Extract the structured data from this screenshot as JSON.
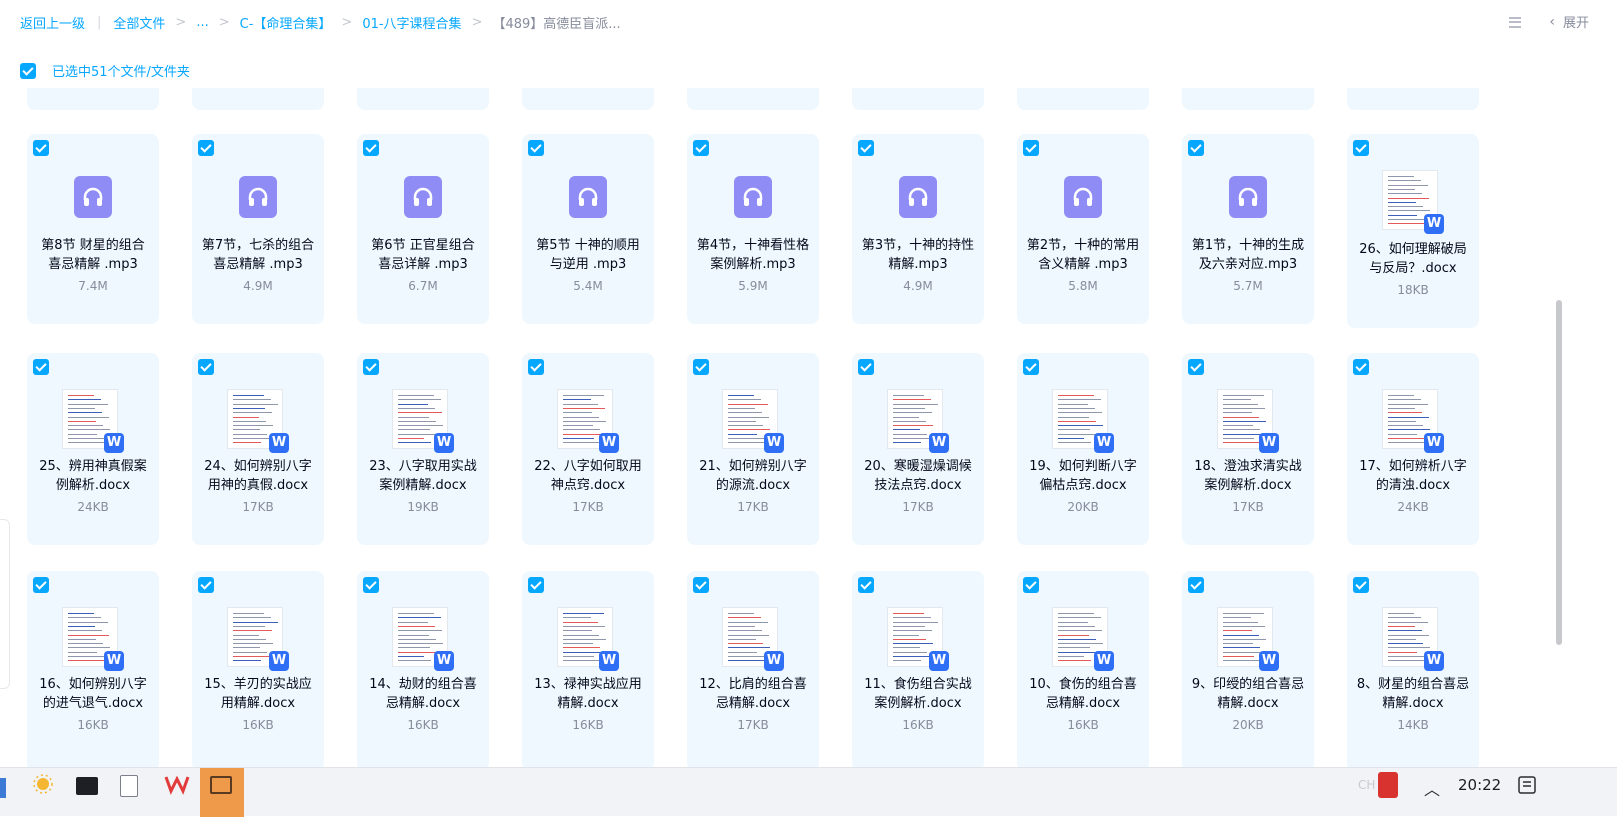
{
  "breadcrumb": {
    "back": "返回上一级",
    "all_files": "全部文件",
    "ellipsis": "...",
    "crumb1": "C-【命理合集】",
    "crumb2": "01-八字课程合集",
    "current": "【489】高德臣盲派..."
  },
  "toolbar": {
    "expand_label": "展开"
  },
  "selection": {
    "label": "已选中51个文件/文件夹"
  },
  "colors": {
    "accent": "#06a7ff",
    "card_bg": "#eef8fe",
    "audio_icon": "#8f8cf5",
    "word_badge": "#2f6ff5"
  },
  "files": {
    "row1": [
      {
        "name_l1": "第8节 财星的组合",
        "name_l2": "喜忌精解 .mp3",
        "size": "7.4M",
        "type": "audio"
      },
      {
        "name_l1": "第7节，七杀的组合",
        "name_l2": "喜忌精解 .mp3",
        "size": "4.9M",
        "type": "audio"
      },
      {
        "name_l1": "第6节 正官星组合",
        "name_l2": "喜忌详解 .mp3",
        "size": "6.7M",
        "type": "audio"
      },
      {
        "name_l1": "第5节 十神的顺用",
        "name_l2": "与逆用 .mp3",
        "size": "5.4M",
        "type": "audio"
      },
      {
        "name_l1": "第4节，十神看性格",
        "name_l2": "案例解析.mp3",
        "size": "5.9M",
        "type": "audio"
      },
      {
        "name_l1": "第3节，十神的持性",
        "name_l2": "精解.mp3",
        "size": "4.9M",
        "type": "audio"
      },
      {
        "name_l1": "第2节，十种的常用",
        "name_l2": "含义精解 .mp3",
        "size": "5.8M",
        "type": "audio"
      },
      {
        "name_l1": "第1节，十神的生成",
        "name_l2": "及六亲对应.mp3",
        "size": "5.7M",
        "type": "audio"
      },
      {
        "name_l1": "26、如何理解破局",
        "name_l2": "与反局？.docx",
        "size": "18KB",
        "type": "docx"
      }
    ],
    "row2": [
      {
        "name_l1": "25、辨用神真假案",
        "name_l2": "例解析.docx",
        "size": "24KB",
        "type": "docx"
      },
      {
        "name_l1": "24、如何辨别八字",
        "name_l2": "用神的真假.docx",
        "size": "17KB",
        "type": "docx"
      },
      {
        "name_l1": "23、八字取用实战",
        "name_l2": "案例精解.docx",
        "size": "19KB",
        "type": "docx"
      },
      {
        "name_l1": "22、八字如何取用",
        "name_l2": "神点窍.docx",
        "size": "17KB",
        "type": "docx"
      },
      {
        "name_l1": "21、如何辨别八字",
        "name_l2": "的源流.docx",
        "size": "17KB",
        "type": "docx"
      },
      {
        "name_l1": "20、寒暖湿燥调候",
        "name_l2": "技法点窍.docx",
        "size": "17KB",
        "type": "docx"
      },
      {
        "name_l1": "19、如何判断八字",
        "name_l2": "偏枯点窍.docx",
        "size": "20KB",
        "type": "docx"
      },
      {
        "name_l1": "18、澄浊求清实战",
        "name_l2": "案例解析.docx",
        "size": "17KB",
        "type": "docx"
      },
      {
        "name_l1": "17、如何辨析八字",
        "name_l2": "的清浊.docx",
        "size": "24KB",
        "type": "docx"
      }
    ],
    "row3": [
      {
        "name_l1": "16、如何辨别八字",
        "name_l2": "的进气退气.docx",
        "size": "16KB",
        "type": "docx"
      },
      {
        "name_l1": "15、羊刃的实战应",
        "name_l2": "用精解.docx",
        "size": "16KB",
        "type": "docx"
      },
      {
        "name_l1": "14、劫财的组合喜",
        "name_l2": "忌精解.docx",
        "size": "16KB",
        "type": "docx"
      },
      {
        "name_l1": "13、禄神实战应用",
        "name_l2": "精解.docx",
        "size": "16KB",
        "type": "docx"
      },
      {
        "name_l1": "12、比肩的组合喜",
        "name_l2": "忌精解.docx",
        "size": "17KB",
        "type": "docx"
      },
      {
        "name_l1": "11、食伤组合实战",
        "name_l2": "案例解析.docx",
        "size": "16KB",
        "type": "docx"
      },
      {
        "name_l1": "10、食伤的组合喜",
        "name_l2": "忌精解.docx",
        "size": "16KB",
        "type": "docx"
      },
      {
        "name_l1": "9、印绶的组合喜忌",
        "name_l2": "精解.docx",
        "size": "20KB",
        "type": "docx"
      },
      {
        "name_l1": "8、财星的组合喜忌",
        "name_l2": "精解.docx",
        "size": "14KB",
        "type": "docx"
      }
    ]
  },
  "icons": {
    "audio": "headphones-icon",
    "docx": "word-doc-icon",
    "checkbox": "checkbox-checked-icon"
  },
  "taskbar": {
    "clock": "20:22",
    "lang": "CH"
  }
}
